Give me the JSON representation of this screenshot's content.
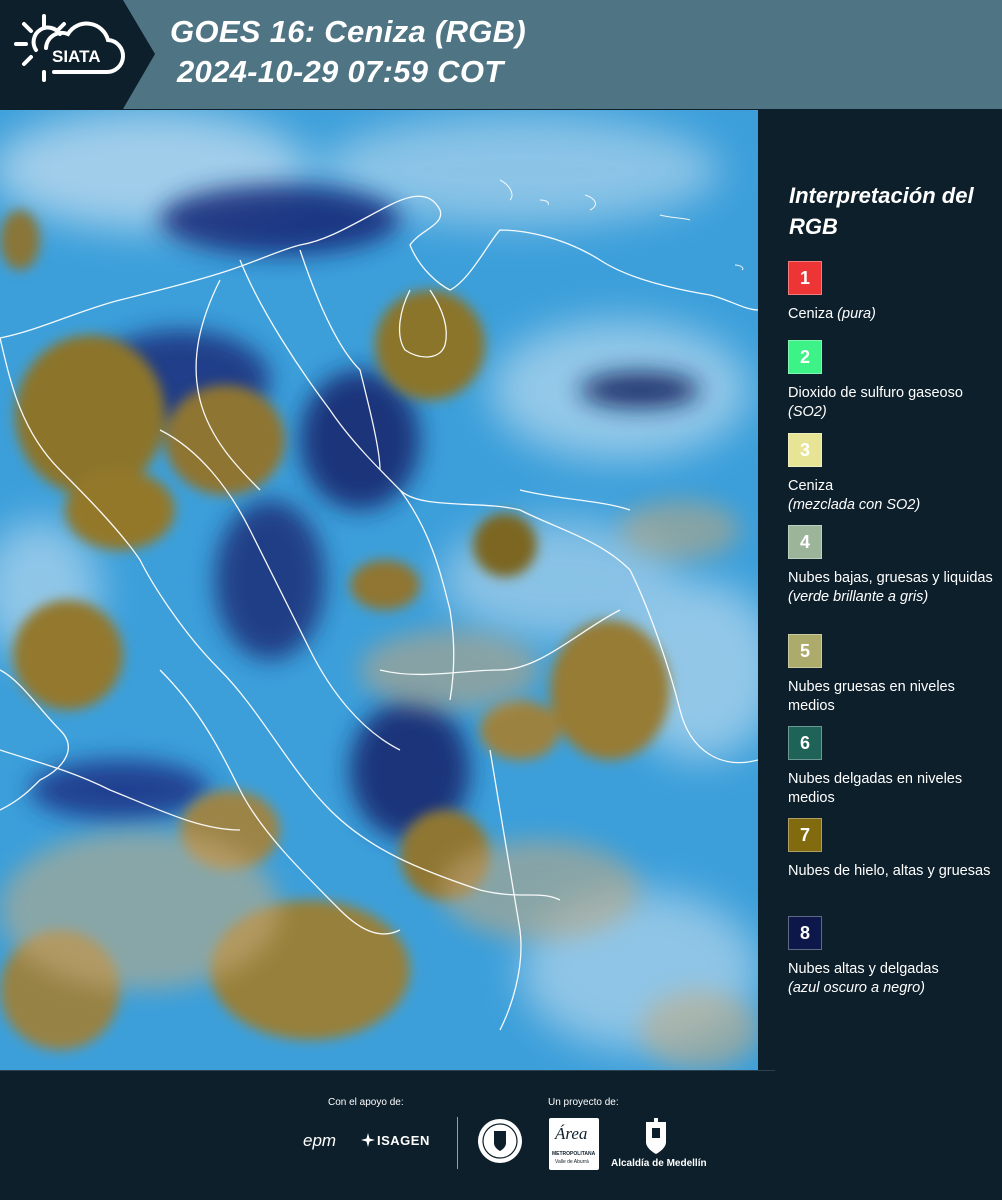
{
  "header": {
    "logo_text": "SIATA",
    "title_line1": "GOES 16: Ceniza (RGB)",
    "title_line2": "2024-10-29 07:59 COT"
  },
  "legend": {
    "title": "Interpretación del RGB",
    "items": [
      {
        "number": "1",
        "color": "#ee3535",
        "label": "Ceniza",
        "note": "(pura)"
      },
      {
        "number": "2",
        "color": "#3df287",
        "label": "Dioxido de sulfuro gaseoso",
        "note": "(SO2)"
      },
      {
        "number": "3",
        "color": "#e7e595",
        "label": "Ceniza",
        "note": "(mezclada con SO2)"
      },
      {
        "number": "4",
        "color": "#9cb59a",
        "label": "Nubes bajas, gruesas y liquidas",
        "note": "(verde brillante a gris)"
      },
      {
        "number": "5",
        "color": "#adab6c",
        "label": "Nubes gruesas en niveles medios",
        "note": ""
      },
      {
        "number": "6",
        "color": "#1e6258",
        "label": "Nubes delgadas en niveles medios",
        "note": ""
      },
      {
        "number": "7",
        "color": "#826b0e",
        "label": "Nubes de hielo, altas y gruesas",
        "note": ""
      },
      {
        "number": "8",
        "color": "#0d1749",
        "label": "Nubes altas y delgadas",
        "note": "(azul oscuro a negro)"
      }
    ]
  },
  "footer": {
    "support_label": "Con el apoyo de:",
    "project_label": "Un proyecto de:",
    "sponsors": [
      "epm",
      "ISAGEN"
    ],
    "partners": [
      "Área Metropolitana Valle de Aburrá",
      "Alcaldía de Medellín"
    ],
    "area_logo_text": "Área",
    "area_logo_sub": "METROPOLITANA",
    "area_logo_sub2": "Valle de Aburrá",
    "alcaldia_text": "Alcaldía de Medellín"
  }
}
